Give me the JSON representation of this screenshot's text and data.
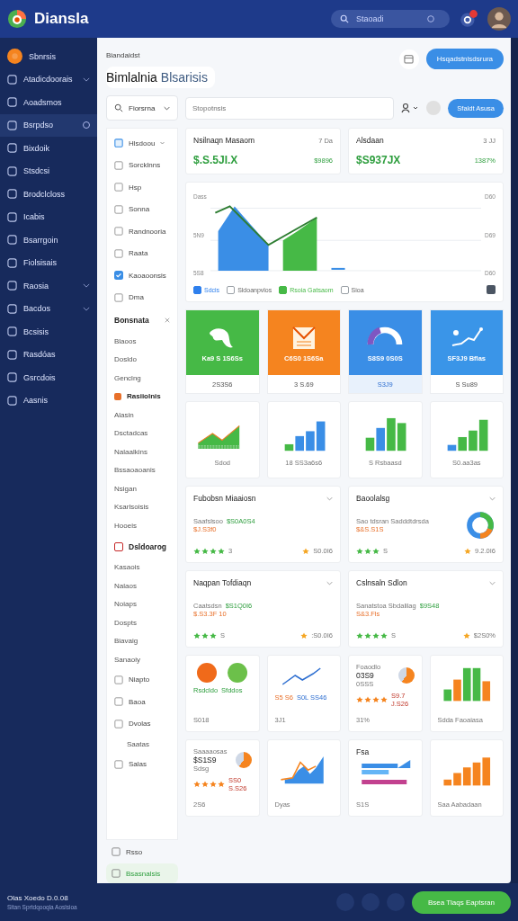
{
  "topbar": {
    "logo_text": "Diansla",
    "search_placeholder": "Staoadi"
  },
  "sidebar": {
    "items": [
      {
        "label": "Sbnrsis",
        "kind": "brand",
        "selected": false
      },
      {
        "label": "Atadicdoorais",
        "kind": "group",
        "selected": false
      },
      {
        "label": "Aoadsmos",
        "kind": "link",
        "selected": false
      },
      {
        "label": "Bsrpdso",
        "kind": "link",
        "selected": true
      },
      {
        "label": "Bixdoik",
        "kind": "link",
        "selected": false
      },
      {
        "label": "Stsdcsi",
        "kind": "link",
        "selected": false
      },
      {
        "label": "Brodclcloss",
        "kind": "link",
        "selected": false
      },
      {
        "label": "Icabis",
        "kind": "link",
        "selected": false
      },
      {
        "label": "Bsarrgoin",
        "kind": "link",
        "selected": false
      },
      {
        "label": "Fiolsisais",
        "kind": "link",
        "selected": false
      },
      {
        "label": "Raosia",
        "kind": "group",
        "selected": false
      },
      {
        "label": "Bacdos",
        "kind": "group",
        "selected": false
      },
      {
        "label": "Bcsisis",
        "kind": "link",
        "selected": false
      },
      {
        "label": "Rasdóas",
        "kind": "link",
        "selected": false
      },
      {
        "label": "Gsrcdois",
        "kind": "link",
        "selected": false
      },
      {
        "label": "Aasnis",
        "kind": "link",
        "selected": false
      }
    ]
  },
  "header": {
    "breadcrumb": "Biandaidst",
    "title": "Bimlalnia",
    "title_tag": "Blsarisis",
    "action": "Hsqadstnlsdsrura"
  },
  "filters": {
    "dropdown": "Fiorsrna",
    "search_placeholder": "Stopotnsis",
    "button": "Sfaldt Asusa"
  },
  "subnav": {
    "entries": [
      {
        "kind": "dropdown",
        "label": "Hlsdoou"
      },
      {
        "kind": "icon-item",
        "label": "Sorcklnns"
      },
      {
        "kind": "icon-item",
        "label": "Hsp"
      },
      {
        "kind": "icon-item",
        "label": "Sonna"
      },
      {
        "kind": "icon-item",
        "label": "Randnooria"
      },
      {
        "kind": "icon-item",
        "label": "Raata"
      },
      {
        "kind": "check-item",
        "label": "Kaoaoonsis"
      },
      {
        "kind": "icon-item",
        "label": "Dma"
      },
      {
        "kind": "closable-header",
        "label": "Bonsnata"
      },
      {
        "kind": "item",
        "label": "Blaoos"
      },
      {
        "kind": "item",
        "label": "Dosldo"
      },
      {
        "kind": "item",
        "label": "Genclng"
      },
      {
        "kind": "marked-item",
        "label": "Rasiiolnis"
      },
      {
        "kind": "item",
        "label": "Alasin"
      },
      {
        "kind": "item",
        "label": "Dsctadcas"
      },
      {
        "kind": "item",
        "label": "Nalaalkins"
      },
      {
        "kind": "item",
        "label": "Bssaoaoanis"
      },
      {
        "kind": "item",
        "label": "Nsigan"
      },
      {
        "kind": "item",
        "label": "Ksarlsoisis"
      },
      {
        "kind": "item",
        "label": "Hooeis"
      },
      {
        "kind": "marked-header",
        "label": "Dsldoarog"
      },
      {
        "kind": "item",
        "label": "Kasaois"
      },
      {
        "kind": "item",
        "label": "Nalaos"
      },
      {
        "kind": "item",
        "label": "Noiaps"
      },
      {
        "kind": "item",
        "label": "Dospts"
      },
      {
        "kind": "item",
        "label": "Biavaig"
      },
      {
        "kind": "item",
        "label": "Sanaoiy"
      },
      {
        "kind": "icon-item",
        "label": "Niapto"
      },
      {
        "kind": "icon-item",
        "label": "Baoa"
      },
      {
        "kind": "icon-item",
        "label": "Dvolas"
      },
      {
        "kind": "sub-item",
        "label": "Saatas"
      },
      {
        "kind": "icon-item",
        "label": "Salas"
      }
    ],
    "footer": [
      {
        "label": "Rsso",
        "selected": false
      },
      {
        "label": "Bsasnalsis",
        "selected": true
      }
    ]
  },
  "stats": [
    {
      "title": "Nsilnaqn Masaom",
      "period": "7 Da",
      "value": "$.S.5JI.X",
      "change": "$9896"
    },
    {
      "title": "Alsdaan",
      "period": "3 JJ",
      "value": "$S937JX",
      "change": "1387%"
    }
  ],
  "chart": {
    "left_labels": [
      "Dass",
      "5N9",
      "5S8"
    ],
    "right_labels": [
      "D60",
      "D69",
      "D60"
    ],
    "legend": [
      {
        "label": "Sdcis",
        "color": "#2f80ed"
      },
      {
        "label": "Sldoanpvlos",
        "color": "#9aa0a6"
      },
      {
        "label": "Rsoia Gatsaom",
        "color": "#46b946"
      },
      {
        "label": "Sioa",
        "color": "#9aa0a6"
      }
    ]
  },
  "tiles": [
    {
      "kind": "map",
      "caption": "Ka9 S 1S6Ss",
      "footer": "2S3S6",
      "color": "#46b946",
      "selected": false
    },
    {
      "kind": "mail",
      "caption": "C6S0 1S6Sa",
      "footer": "3 S.69",
      "color": "#f5841f",
      "selected": false
    },
    {
      "kind": "gauge",
      "caption": "S8S9 0S0S",
      "footer": "S3J9",
      "color": "#3a8ee6",
      "selected": true
    },
    {
      "kind": "trend",
      "caption": "SF3J9 Bflas",
      "footer": "S Su89",
      "color": "#3a95e8",
      "selected": false
    }
  ],
  "mini_charts": [
    {
      "kind": "area",
      "caption": "Sdod"
    },
    {
      "kind": "blue-bars",
      "caption": "18 SS3a6s6"
    },
    {
      "kind": "green-bars",
      "caption": "S Rsbaasd"
    },
    {
      "kind": "mixed-bars",
      "caption": "S0.aa3as"
    }
  ],
  "products": [
    {
      "title": "Fubobsn Miaaiosn",
      "label": "Saafslsoo",
      "value": "$S0A0S4",
      "price": "$J.S3f0",
      "stars": 4,
      "count": "3",
      "rating": "S0.0I6",
      "donut": false
    },
    {
      "title": "Baoolalsg",
      "label": "Sao tdsran Sadddtdrsda",
      "price": "$&S.S1S",
      "stars": 3,
      "count": "S",
      "rating": "9.2.0I6",
      "donut": true
    },
    {
      "title": "Naqpan Tofdiaqn",
      "label": "Caatsdsn",
      "value": "$S1Q0I6",
      "price": "$.S3.3F 10",
      "stars": 3,
      "count": "S",
      "rating": ":S0.0I6",
      "donut": false
    },
    {
      "title": "Cslnsaln Sdlon",
      "label": "Sanatstoa Sbdalilag",
      "value": "$9S48",
      "price": "S&3.Fls",
      "stars": 4,
      "count": "S",
      "rating": "$2S0%",
      "donut": false
    }
  ],
  "widgets": [
    {
      "kind": "circles",
      "title": "Rsdcldo",
      "value": "Sfddos",
      "footer": "S018"
    },
    {
      "kind": "line",
      "title": "S5 S6",
      "value": "S0L SS46",
      "footer": "3J1"
    },
    {
      "kind": "rated",
      "title": "Foaodlo",
      "value": "03S9",
      "note": "0SSS",
      "stars": 4,
      "rating": "S9.7 J.S26",
      "footer": "31%"
    },
    {
      "kind": "bars",
      "footer": "Sdda Faoaiasa"
    },
    {
      "kind": "rated",
      "title": "Saaaaosas",
      "value": "$S1S9",
      "note": "Sdsg",
      "stars": 4,
      "rating": "SS0 S.S26",
      "footer": "2S6"
    },
    {
      "kind": "area",
      "footer": "Dyas"
    },
    {
      "kind": "hbar",
      "title": "Fsa",
      "footer": "S1S"
    },
    {
      "kind": "orange-bars",
      "footer": "Saa Aabadaan"
    }
  ],
  "footer": {
    "title": "Olas Xoedo D.0.08",
    "subtitle": "Sitan Sprtdqooqla Aoslsioa",
    "button": "Bsea Tlaqs Eaptsran"
  }
}
